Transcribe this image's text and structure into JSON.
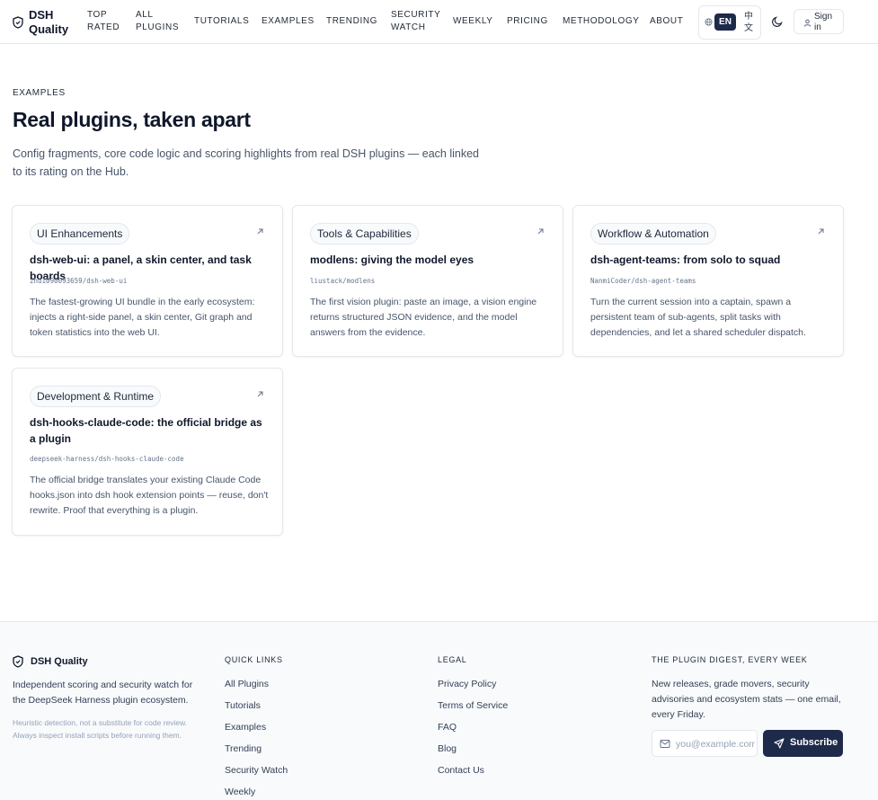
{
  "header": {
    "brand": "DSH Quality",
    "nav": [
      "Top Rated",
      "All Plugins",
      "Tutorials",
      "Examples",
      "Trending",
      "Security Watch",
      "Weekly",
      "Pricing",
      "Methodology",
      "About"
    ],
    "lang_active": "EN",
    "lang_alt": "中文",
    "signin_label": "Sign in"
  },
  "intro": {
    "eyebrow": "EXAMPLES",
    "title": "Real plugins, taken apart",
    "subtitle": "Config fragments, core code logic and scoring highlights from real DSH plugins — each linked to its rating on the Hub."
  },
  "cards": [
    {
      "tag": "UI Enhancements",
      "title": "dsh-web-ui: a panel, a skin center, and task boards",
      "repo": "zhu1090093659/dsh-web-ui",
      "desc": "The fastest-growing UI bundle in the early ecosystem: injects a right-side panel, a skin center, Git graph and token statistics into the web UI."
    },
    {
      "tag": "Tools & Capabilities",
      "title": "modlens: giving the model eyes",
      "repo": "liustack/modlens",
      "desc": "The first vision plugin: paste an image, a vision engine returns structured JSON evidence, and the model answers from the evidence."
    },
    {
      "tag": "Workflow & Automation",
      "title": "dsh-agent-teams: from solo to squad",
      "repo": "NanmiCoder/dsh-agent-teams",
      "desc": "Turn the current session into a captain, spawn a persistent team of sub-agents, split tasks with dependencies, and let a shared scheduler dispatch."
    },
    {
      "tag": "Development & Runtime",
      "title": "dsh-hooks-claude-code: the official bridge as a plugin",
      "repo": "deepseek-harness/dsh-hooks-claude-code",
      "desc": "The official bridge translates your existing Claude Code hooks.json into dsh hook extension points — reuse, don't rewrite. Proof that everything is a plugin."
    }
  ],
  "footer": {
    "brand": "DSH Quality",
    "tagline": "Independent scoring and security watch for the DeepSeek Harness plugin ecosystem.",
    "disclaimer": "Heuristic detection, not a substitute for code review. Always inspect install scripts before running them.",
    "quick_links_heading": "QUICK LINKS",
    "quick_links": [
      "All Plugins",
      "Tutorials",
      "Examples",
      "Trending",
      "Security Watch",
      "Weekly"
    ],
    "legal_heading": "LEGAL",
    "legal_links": [
      "Privacy Policy",
      "Terms of Service",
      "FAQ",
      "Blog",
      "Contact Us"
    ],
    "digest_heading": "THE PLUGIN DIGEST, EVERY WEEK",
    "digest_text": "New releases, grade movers, security advisories and ecosystem stats — one email, every Friday.",
    "email_placeholder": "you@example.com",
    "subscribe_label": "Subscribe"
  },
  "colors": {
    "accent": "#1e2a4a",
    "text": "#0f172a",
    "muted": "#475569",
    "border": "#e5e7eb",
    "footer_bg": "#f8fafc"
  },
  "icons": [
    "shield-icon",
    "globe-icon",
    "moon-icon",
    "user-icon",
    "arrow-up-right-icon",
    "mail-icon",
    "send-icon"
  ]
}
